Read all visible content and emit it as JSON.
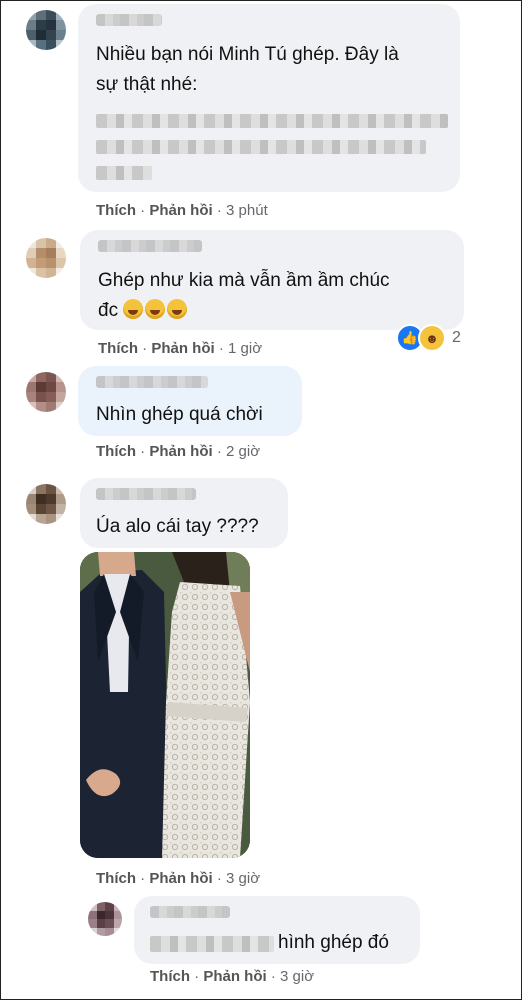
{
  "comments": [
    {
      "text_lines": [
        "Nhiều bạn nói Minh Tú ghép. Đây là",
        "sự thật nhé:"
      ],
      "like_label": "Thích",
      "reply_label": "Phản hồi",
      "time": "3 phút"
    },
    {
      "text_lines": [
        "Ghép như kia mà vẫn ầm ầm chúc",
        "đc"
      ],
      "emoji": [
        "laughing-crying",
        "laughing-crying",
        "laughing-crying"
      ],
      "reaction_count": "2",
      "reaction_icons": [
        "like-icon",
        "haha-icon"
      ],
      "like_label": "Thích",
      "reply_label": "Phản hồi",
      "time": "1 giờ"
    },
    {
      "text_lines": [
        "Nhìn ghép quá chời"
      ],
      "like_label": "Thích",
      "reply_label": "Phản hồi",
      "time": "2 giờ"
    },
    {
      "text_lines": [
        "Úa alo cái tay ????"
      ],
      "like_label": "Thích",
      "reply_label": "Phản hồi",
      "time": "3 giờ"
    },
    {
      "text_lines": [
        "hình ghép đó"
      ],
      "like_label": "Thích",
      "reply_label": "Phản hồi",
      "time": "3 giờ"
    }
  ],
  "colors": {
    "bubble": "#eff1f5",
    "meta_text": "#65676b",
    "like_blue": "#1877f2",
    "haha_yellow": "#f5c33b"
  }
}
